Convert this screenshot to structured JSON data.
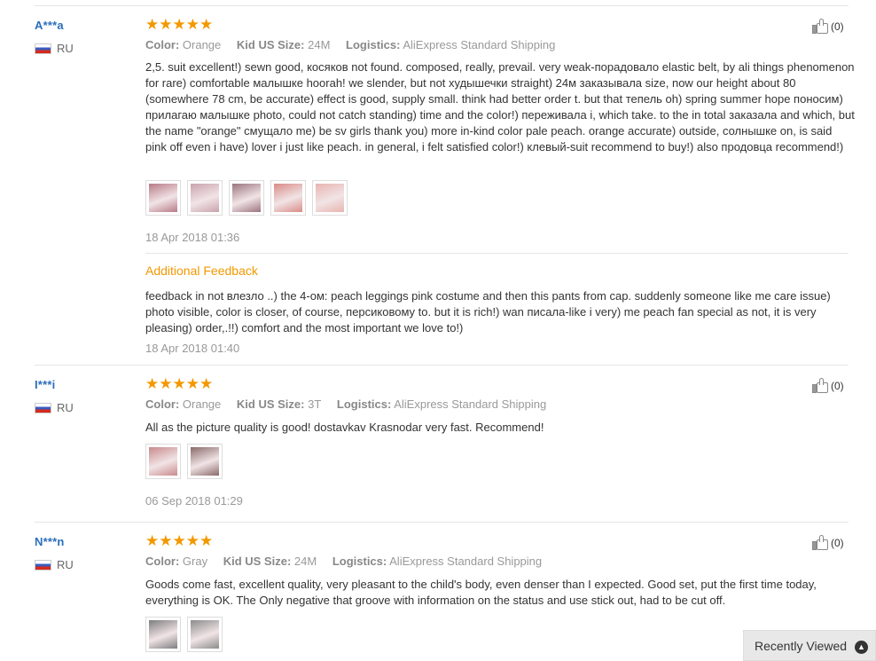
{
  "labels": {
    "color": "Color:",
    "size": "Kid US Size:",
    "logistics": "Logistics:",
    "additional_feedback": "Additional Feedback",
    "stars": "★★★★★"
  },
  "reviews": [
    {
      "user": "A***a",
      "country": "RU",
      "rating": 5,
      "color": "Orange",
      "size": "24M",
      "logistics": "AliExpress Standard Shipping",
      "helpful": "(0)",
      "text": "2,5. suit excellent!) sewn good, косяков not found. composed, really, prevail. very weak-порадовало elastic belt, by ali things phenomenon for rare) comfortable малышке hoorah! we slender, but not худышечки straight) 24м заказывала size, now our height about 80 (somewhere 78 cm, be accurate) effect is good, supply small. think had better order t. but that тепель oh) spring summer hope поносим) прилагаю малышке photo, could not catch standing) time and the color!) переживала i, which take. to the in total заказала and which, but the name \"orange\" смущало me) be sv girls thank you) more in-kind color pale peach. orange accurate) outside, солнышке on, is said pink off even i have) lover i just like peach. in general, i felt satisfied color!) клевый-suit recommend to buy!) also продовца recommend!)",
      "date": "18 Apr 2018 01:36",
      "photos": [
        "#b87a86",
        "#c9a3ad",
        "#9c7480",
        "#d98b87",
        "#e8b5b0"
      ],
      "additional_text": "feedback in not влезло ..) the 4-ом: peach leggings pink costume and then this pants from cap. suddenly someone like me care issue) photo visible, color is closer, of course, персиковому to. but it is rich!) wan писала-like i very) me peach fan special as not, it is very pleasing) order,.!!) comfort and the most important we love to!)",
      "additional_date": "18 Apr 2018 01:40"
    },
    {
      "user": "I***i",
      "country": "RU",
      "rating": 5,
      "color": "Orange",
      "size": "3T",
      "logistics": "AliExpress Standard Shipping",
      "helpful": "(0)",
      "text": "All as the picture quality is good! dostavkav Krasnodar very fast. Recommend!",
      "date": "06 Sep 2018 01:29",
      "photos": [
        "#c98a8c",
        "#8a6a6a"
      ]
    },
    {
      "user": "N***n",
      "country": "RU",
      "rating": 5,
      "color": "Gray",
      "size": "24M",
      "logistics": "AliExpress Standard Shipping",
      "helpful": "(0)",
      "text": "Goods come fast, excellent quality, very pleasant to the child's body, even denser than I expected. Good set, put the first time today, everything is OK. The Only negative that groove with information on the status and use stick out, had to be cut off.",
      "photos": [
        "#7d7d80",
        "#8b8b8b"
      ]
    }
  ],
  "recently_viewed": "Recently Viewed",
  "colors": {
    "star": "#f39800",
    "user": "#2a6ebb",
    "accent": "#f39800"
  }
}
